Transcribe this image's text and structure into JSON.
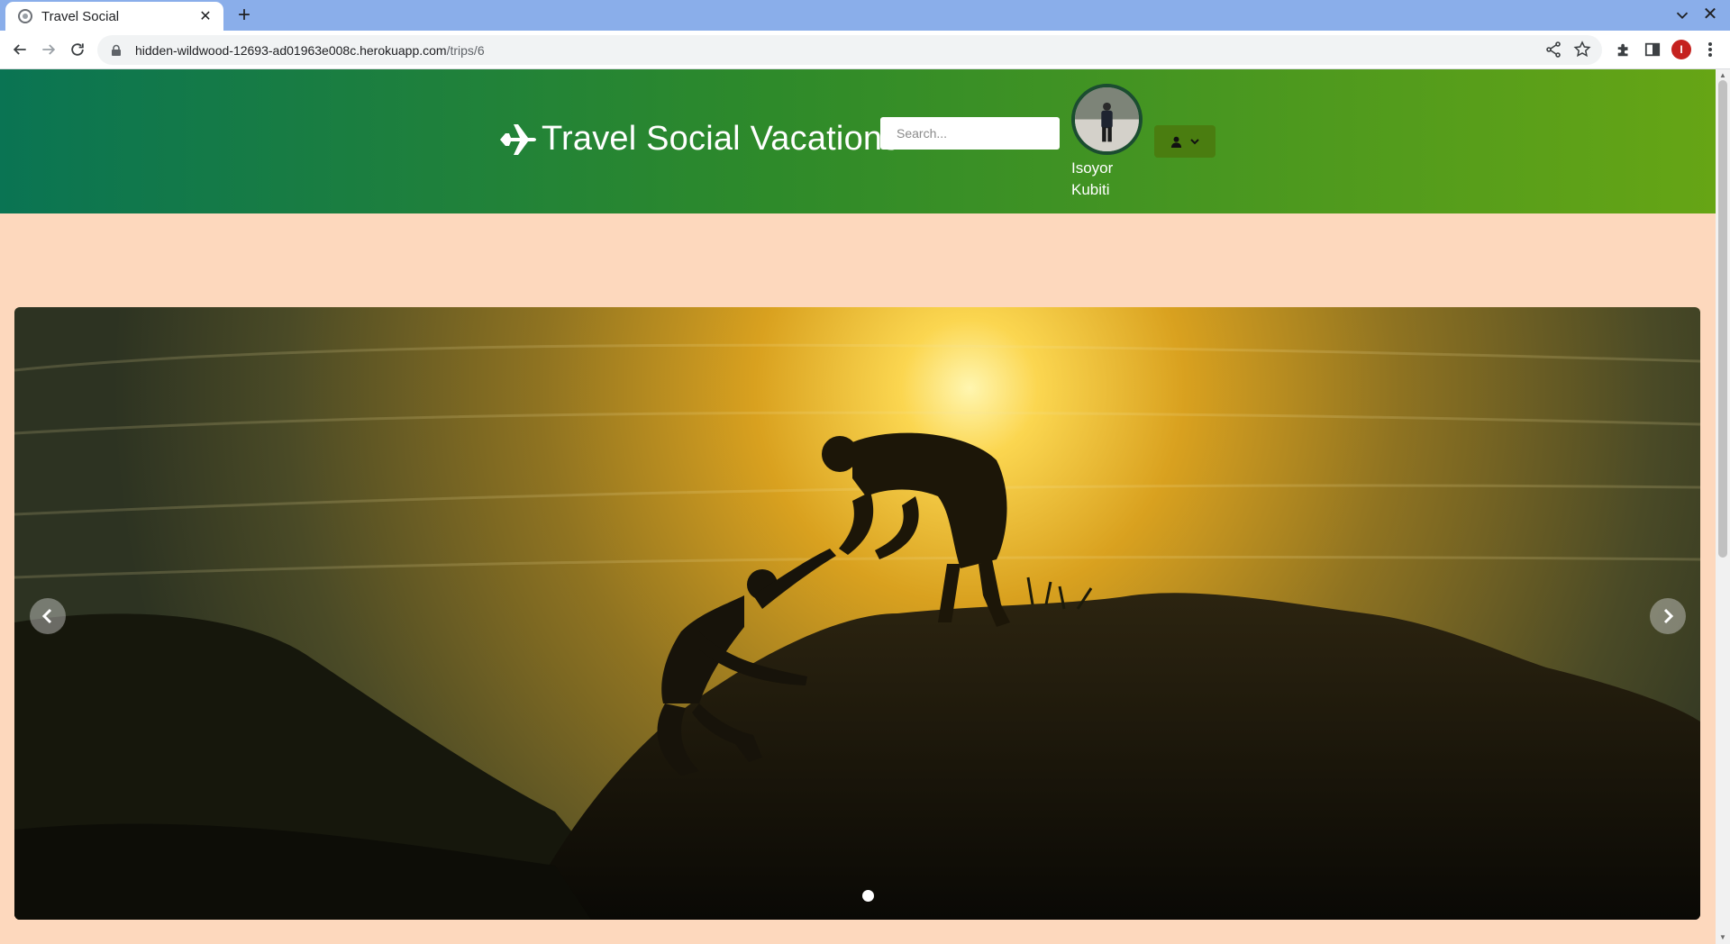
{
  "browser": {
    "tab_title": "Travel Social",
    "url_host": "hidden-wildwood-12693-ad01963e008c.herokuapp.com",
    "url_path": "/trips/6",
    "profile_initial": "I"
  },
  "header": {
    "brand": "Travel Social Vacations",
    "search_placeholder": "Search...",
    "user_first_name": "Isoyor",
    "user_last_name": "Kubiti"
  },
  "carousel": {
    "slides": 1,
    "active_slide": 1
  },
  "colors": {
    "page_background": "#fdd8bd",
    "header_gradient_start": "#0a7453",
    "header_gradient_end": "#66a515",
    "user_menu_button": "#4a7d10"
  }
}
